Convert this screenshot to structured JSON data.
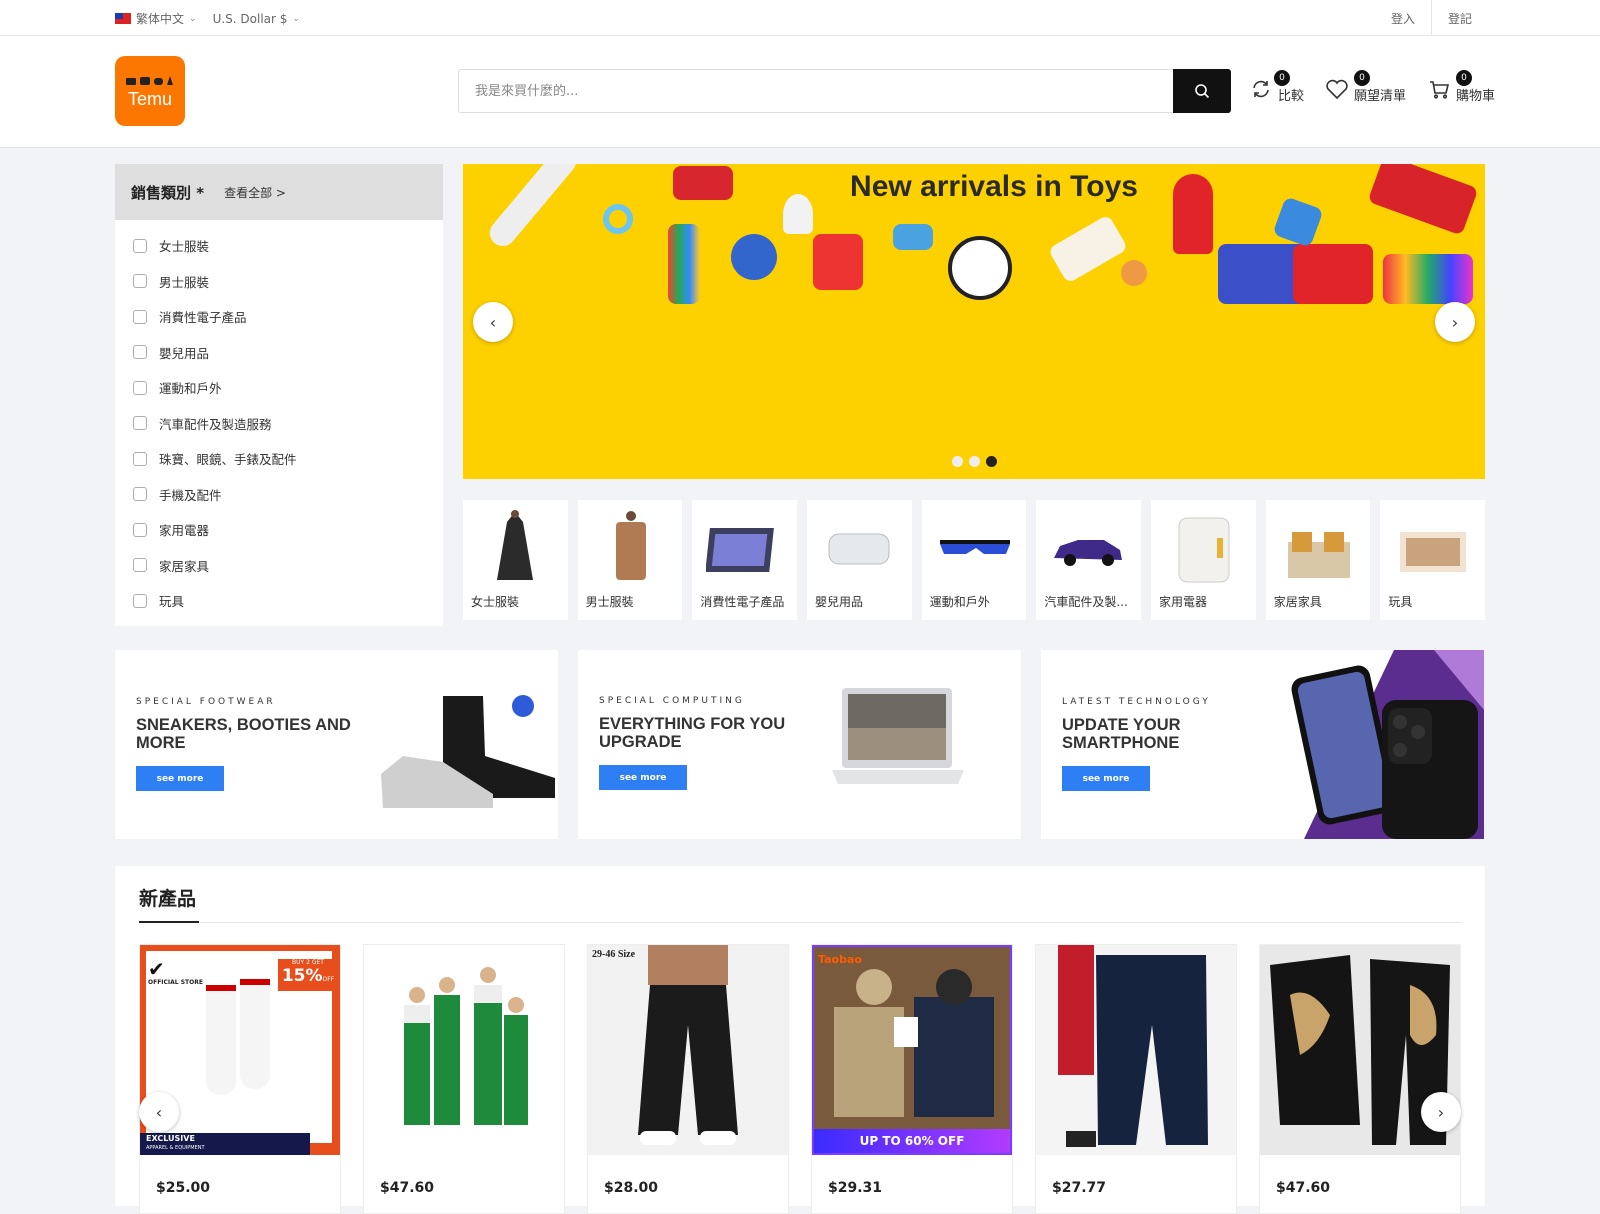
{
  "topbar": {
    "language": "繁体中文",
    "currency": "U.S. Dollar $",
    "login": "登入",
    "register": "登記"
  },
  "header": {
    "logo_text": "Temu",
    "search_placeholder": "我是來買什麼的...",
    "compare_label": "比較",
    "compare_count": "0",
    "wishlist_label": "願望清單",
    "wishlist_count": "0",
    "cart_label": "購物車",
    "cart_count": "0"
  },
  "sidebar": {
    "title": "銷售類別 *",
    "view_all": "查看全部 >",
    "items": [
      {
        "label": "女士服裝"
      },
      {
        "label": "男士服裝"
      },
      {
        "label": "消費性電子產品"
      },
      {
        "label": "嬰兒用品"
      },
      {
        "label": "運動和戶外"
      },
      {
        "label": "汽車配件及製造服務"
      },
      {
        "label": "珠寶、眼鏡、手錶及配件"
      },
      {
        "label": "手機及配件"
      },
      {
        "label": "家用電器"
      },
      {
        "label": "家居家具"
      },
      {
        "label": "玩具"
      }
    ]
  },
  "hero": {
    "title": "New arrivals in Toys",
    "background": "#fdd000",
    "slide_count": 3,
    "active_slide": 3
  },
  "categories": [
    {
      "label": "女士服裝",
      "color": "#2b2b2b"
    },
    {
      "label": "男士服裝",
      "color": "#b07a52"
    },
    {
      "label": "消費性電子產品",
      "color": "#3d3f5f"
    },
    {
      "label": "嬰兒用品",
      "color": "#cfd3d8"
    },
    {
      "label": "運動和戶外",
      "color": "#2a4fd6"
    },
    {
      "label": "汽車配件及製...",
      "color": "#3f2a8a"
    },
    {
      "label": "家用電器",
      "color": "#e8e6e2"
    },
    {
      "label": "家居家具",
      "color": "#d69a3b"
    },
    {
      "label": "玩具",
      "color": "#c9a27e"
    }
  ],
  "promos": [
    {
      "eyebrow": "SPECIAL FOOTWEAR",
      "heading": "SNEAKERS, BOOTIES AND MORE",
      "button": "see more"
    },
    {
      "eyebrow": "SPECIAL COMPUTING",
      "heading": "EVERYTHING FOR YOU UPGRADE",
      "button": "see more"
    },
    {
      "eyebrow": "LATEST TECHNOLOGY",
      "heading": "UPDATE YOUR SMARTPHONE",
      "button": "see more"
    }
  ],
  "new_products": {
    "title": "新產品",
    "items": [
      {
        "price": "$25.00",
        "badge_top": "BUY 2 GET",
        "badge_big": "15%",
        "badge_off": "OFF",
        "brand": "OFFICIAL STORE",
        "footer": "EXCLUSIVE",
        "footer_sub": "APPAREL & EQUIPMENT"
      },
      {
        "price": "$47.60"
      },
      {
        "price": "$28.00",
        "tag": "29-46 Size"
      },
      {
        "price": "$29.31",
        "tag": "Taobao",
        "banner": "UP TO 60% OFF"
      },
      {
        "price": "$27.77"
      },
      {
        "price": "$47.60"
      }
    ]
  },
  "colors": {
    "accent": "#fb7701",
    "button_blue": "#2e7ff4",
    "dark": "#111111"
  }
}
